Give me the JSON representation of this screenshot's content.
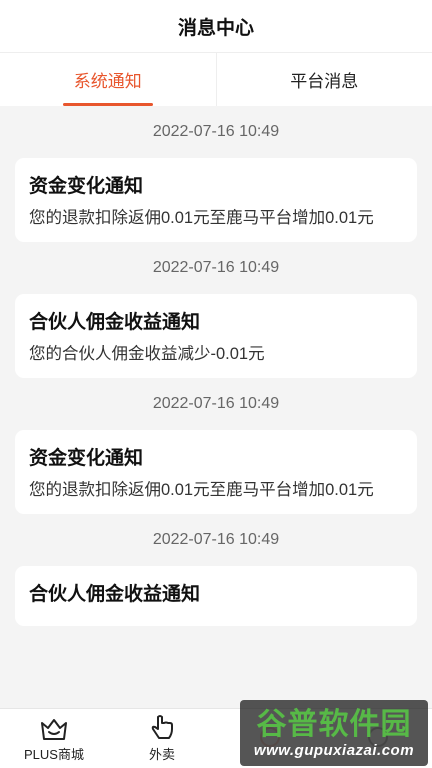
{
  "header": {
    "title": "消息中心"
  },
  "tabs": [
    {
      "label": "系统通知",
      "active": true
    },
    {
      "label": "平台消息",
      "active": false
    }
  ],
  "accent_color": "#e8562d",
  "messages": [
    {
      "time": "2022-07-16 10:49",
      "title": "资金变化通知",
      "body": "您的退款扣除返佣0.01元至鹿马平台增加0.01元"
    },
    {
      "time": "2022-07-16 10:49",
      "title": "合伙人佣金收益通知",
      "body": "您的合伙人佣金收益减少-0.01元"
    },
    {
      "time": "2022-07-16 10:49",
      "title": "资金变化通知",
      "body": "您的退款扣除返佣0.01元至鹿马平台增加0.01元"
    },
    {
      "time": "2022-07-16 10:49",
      "title": "合伙人佣金收益通知",
      "body": ""
    }
  ],
  "bottom_nav": [
    {
      "label": "PLUS商城",
      "icon": "crown-basket-icon"
    },
    {
      "label": "外卖",
      "icon": "hand-pointer-icon"
    },
    {
      "label": "",
      "icon": "hidden-icon"
    },
    {
      "label": "",
      "icon": "hidden-icon"
    }
  ],
  "watermark": {
    "title": "谷普软件园",
    "url": "www.gupuxiazai.com"
  }
}
